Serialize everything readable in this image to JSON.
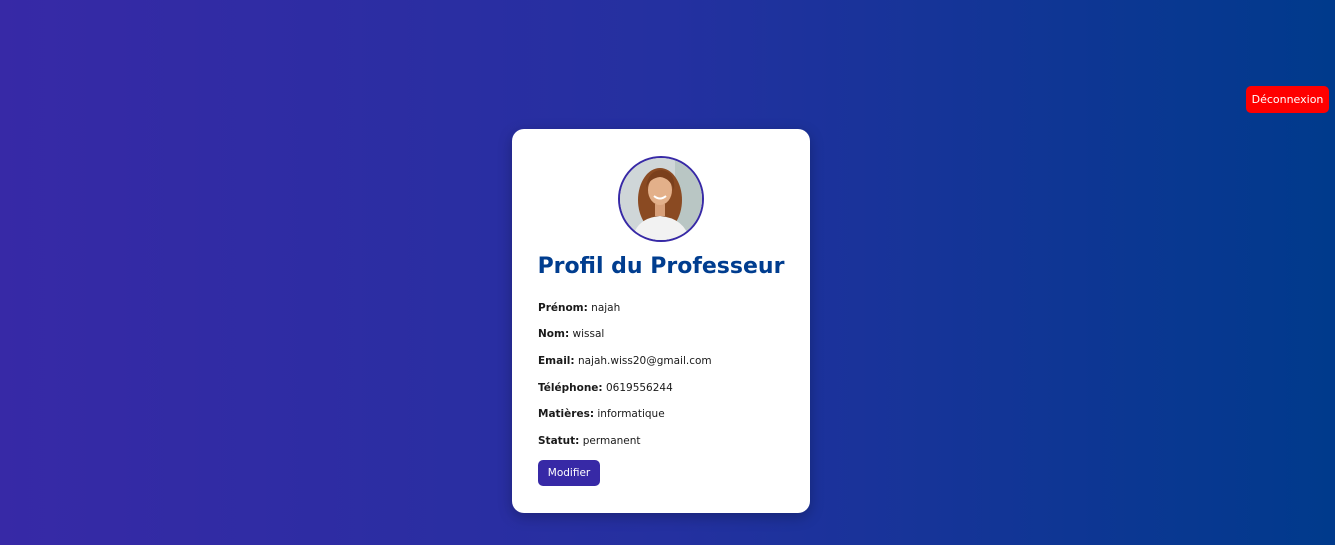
{
  "header": {
    "logout_label": "Déconnexion"
  },
  "profile": {
    "title": "Profil du Professeur",
    "fields": [
      {
        "label": "Prénom:",
        "value": "najah"
      },
      {
        "label": "Nom:",
        "value": "wissal"
      },
      {
        "label": "Email:",
        "value": "najah.wiss20@gmail.com"
      },
      {
        "label": "Téléphone:",
        "value": "0619556244"
      },
      {
        "label": "Matières:",
        "value": "informatique"
      },
      {
        "label": "Statut:",
        "value": "permanent"
      }
    ],
    "edit_label": "Modifier"
  },
  "colors": {
    "background_start": "#3729a6",
    "background_end": "#003a8c",
    "title": "#003d8f",
    "logout_button": "#ff0000",
    "edit_button": "#3729a6"
  }
}
